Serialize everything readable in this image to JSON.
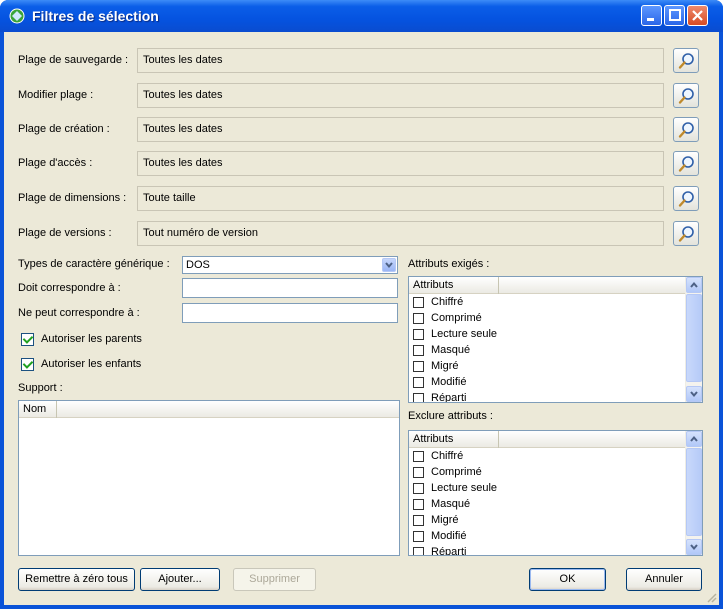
{
  "window": {
    "title": "Filtres de sélection"
  },
  "ranges": [
    {
      "label": "Plage de sauvegarde :",
      "value": "Toutes les dates"
    },
    {
      "label": "Modifier plage :",
      "value": "Toutes les dates"
    },
    {
      "label": "Plage de création :",
      "value": "Toutes les dates"
    },
    {
      "label": "Plage d'accès :",
      "value": "Toutes les dates"
    },
    {
      "label": "Plage de dimensions :",
      "value": "Toute taille"
    },
    {
      "label": "Plage de versions :",
      "value": "Tout numéro de version"
    }
  ],
  "wildcard": {
    "label": "Types de caractère générique :",
    "value": "DOS"
  },
  "must_match": {
    "label": "Doit correspondre à :",
    "value": ""
  },
  "must_not_match": {
    "label": "Ne peut correspondre à :",
    "value": ""
  },
  "allow_parents": {
    "label": "Autoriser les parents",
    "checked": true
  },
  "allow_children": {
    "label": "Autoriser les enfants",
    "checked": true
  },
  "support": {
    "label": "Support :",
    "column": "Nom"
  },
  "required_attrs": {
    "label": "Attributs exigés :",
    "column": "Attributs",
    "items": [
      "Chiffré",
      "Comprimé",
      "Lecture seule",
      "Masqué",
      "Migré",
      "Modifié",
      "Réparti"
    ]
  },
  "exclude_attrs": {
    "label": "Exclure attributs :",
    "column": "Attributs",
    "items": [
      "Chiffré",
      "Comprimé",
      "Lecture seule",
      "Masqué",
      "Migré",
      "Modifié",
      "Réparti"
    ]
  },
  "buttons": {
    "reset": "Remettre à zéro tous",
    "add": "Ajouter...",
    "delete": "Supprimer",
    "ok": "OK",
    "cancel": "Annuler"
  },
  "colors": {
    "titlebar": "#0553e0",
    "dialog_bg": "#ece9d8",
    "check": "#21a121"
  }
}
